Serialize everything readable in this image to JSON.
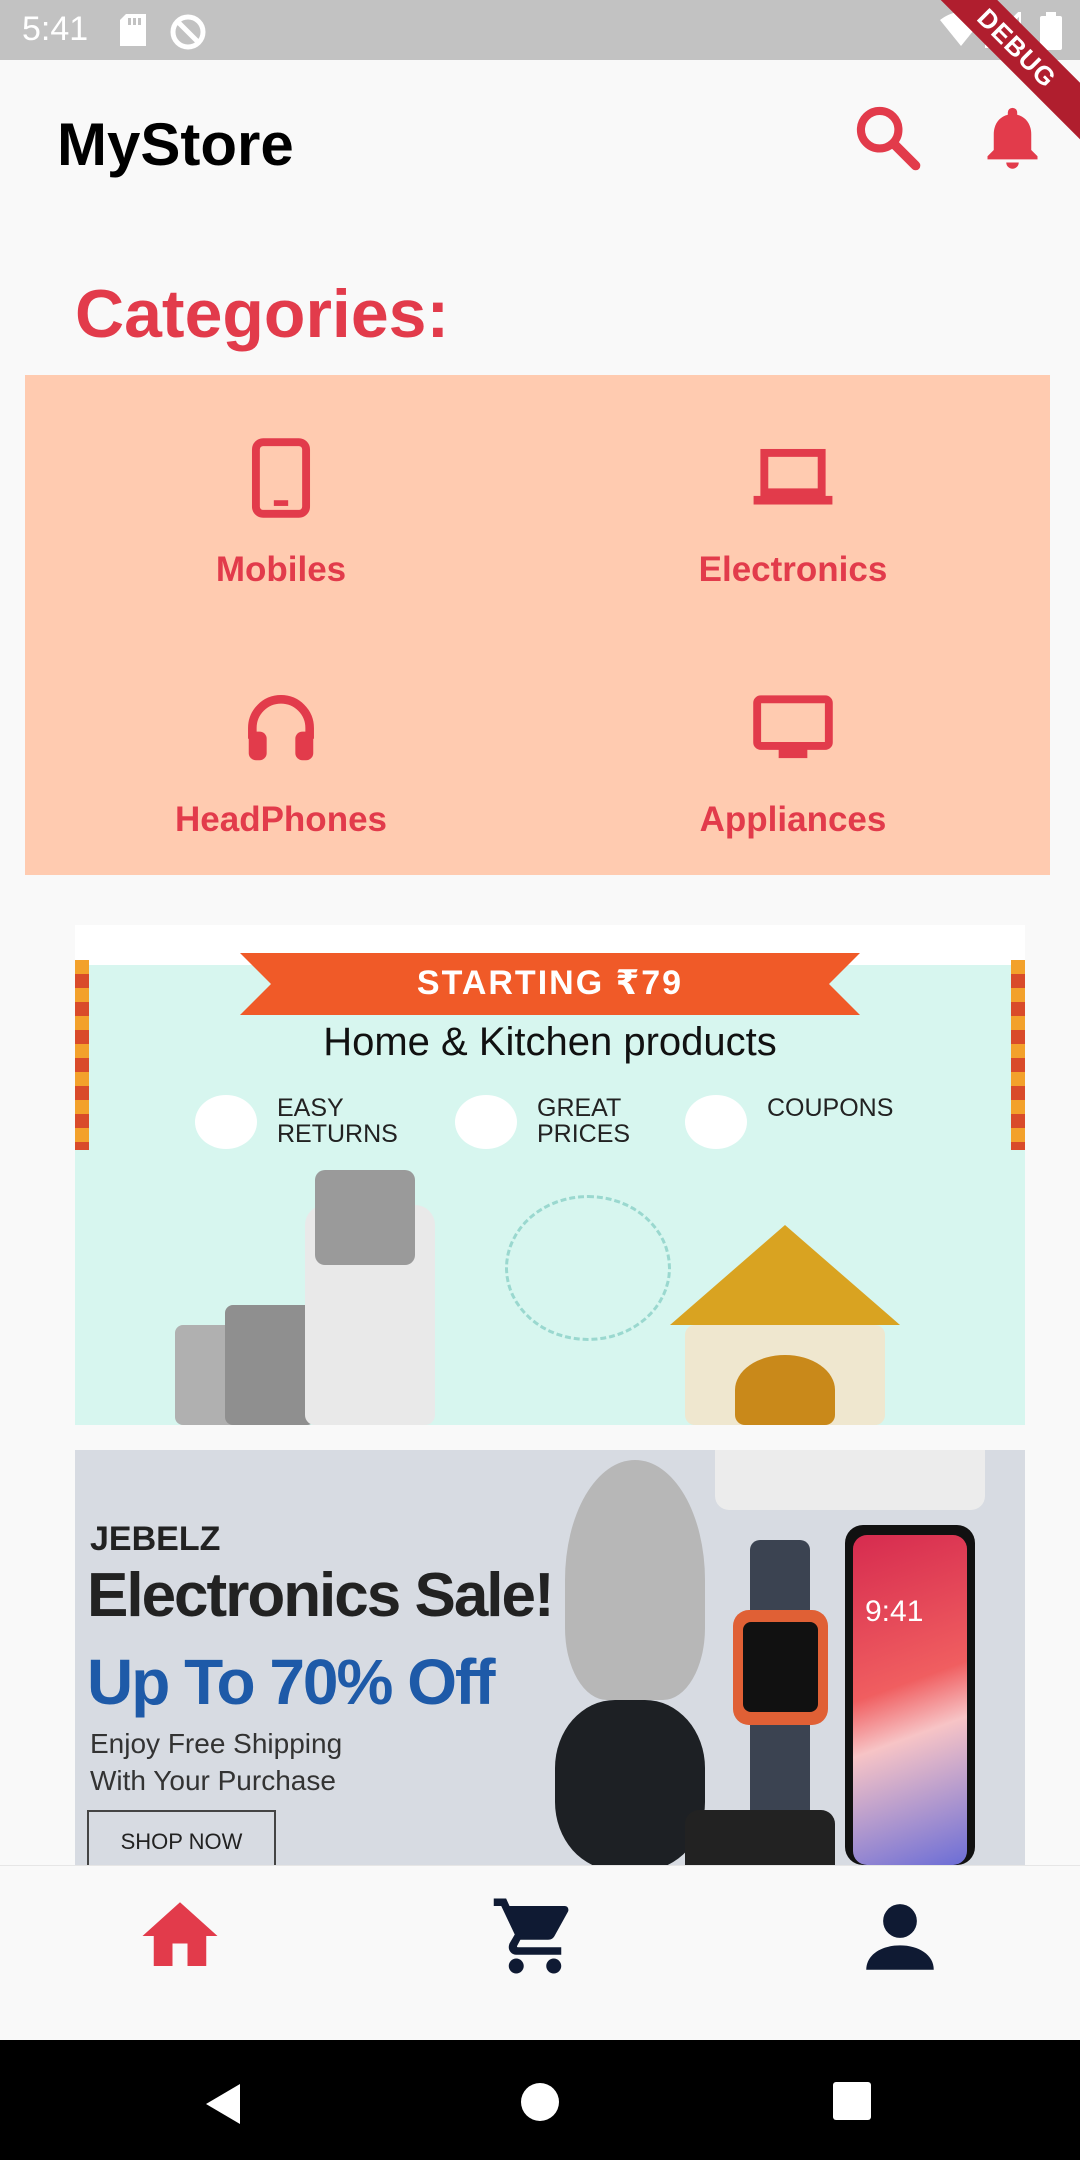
{
  "status_bar": {
    "time": "5:41"
  },
  "debug_banner": "DEBUG",
  "app_bar": {
    "title": "MyStore",
    "search_icon": "search-icon",
    "notification_icon": "bell-icon"
  },
  "colors": {
    "accent": "#e23b4b",
    "categories_bg": "#ffcbb0",
    "nav_dark": "#0f1a33"
  },
  "categories": {
    "title": "Categories:",
    "items": [
      {
        "label": "Mobiles",
        "icon": "tablet-icon"
      },
      {
        "label": "Electronics",
        "icon": "laptop-icon"
      },
      {
        "label": "HeadPhones",
        "icon": "headphones-icon"
      },
      {
        "label": "Appliances",
        "icon": "monitor-icon"
      }
    ]
  },
  "banners": [
    {
      "ribbon": "STARTING ₹79",
      "heading": "Home & Kitchen products",
      "features": [
        "EASY RETURNS",
        "GREAT PRICES",
        "COUPONS"
      ]
    },
    {
      "brand": "JEBELZ",
      "title": "Electronics Sale!",
      "offer": "Up To 70% Off",
      "sub_line1": "Enjoy Free Shipping",
      "sub_line2": "With Your Purchase",
      "button": "SHOP NOW",
      "phone_time": "9:41"
    }
  ],
  "bottom_nav": {
    "items": [
      {
        "icon": "home-icon",
        "active": true
      },
      {
        "icon": "cart-icon",
        "active": false
      },
      {
        "icon": "profile-icon",
        "active": false
      }
    ]
  }
}
